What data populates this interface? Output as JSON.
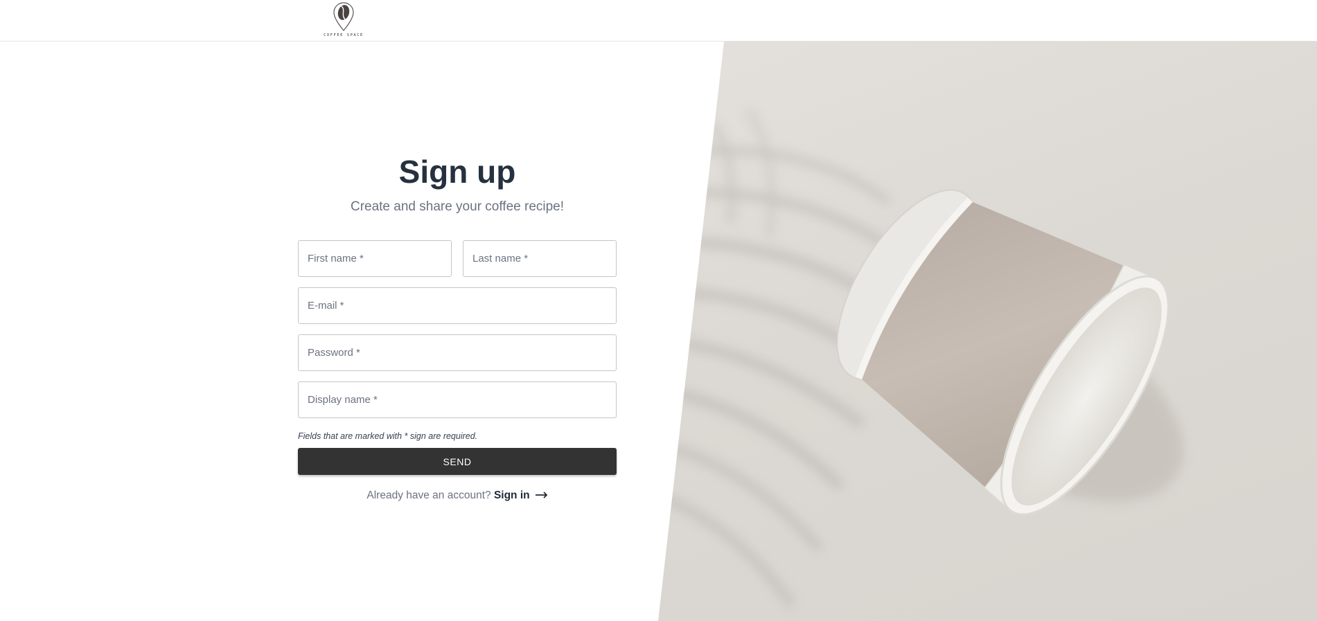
{
  "header": {
    "logo_text": "COFFEE SPACE"
  },
  "form": {
    "title": "Sign up",
    "subtitle": "Create and share your coffee recipe!",
    "fields": {
      "first_name": "First name *",
      "last_name": "Last name *",
      "email": "E-mail *",
      "password": "Password *",
      "display_name": "Display name *"
    },
    "required_note": "Fields that are marked with * sign are required.",
    "send_label": "SEND",
    "signin_prompt": "Already have an account?",
    "signin_link": "Sign in"
  },
  "colors": {
    "button_bg": "#333333",
    "title": "#263140",
    "muted_text": "#6b7280",
    "hero_bg": "#dcd8d3"
  },
  "icons": {
    "logo": "coffee-bean-pin-icon",
    "signin_arrow": "arrow-right-icon"
  }
}
